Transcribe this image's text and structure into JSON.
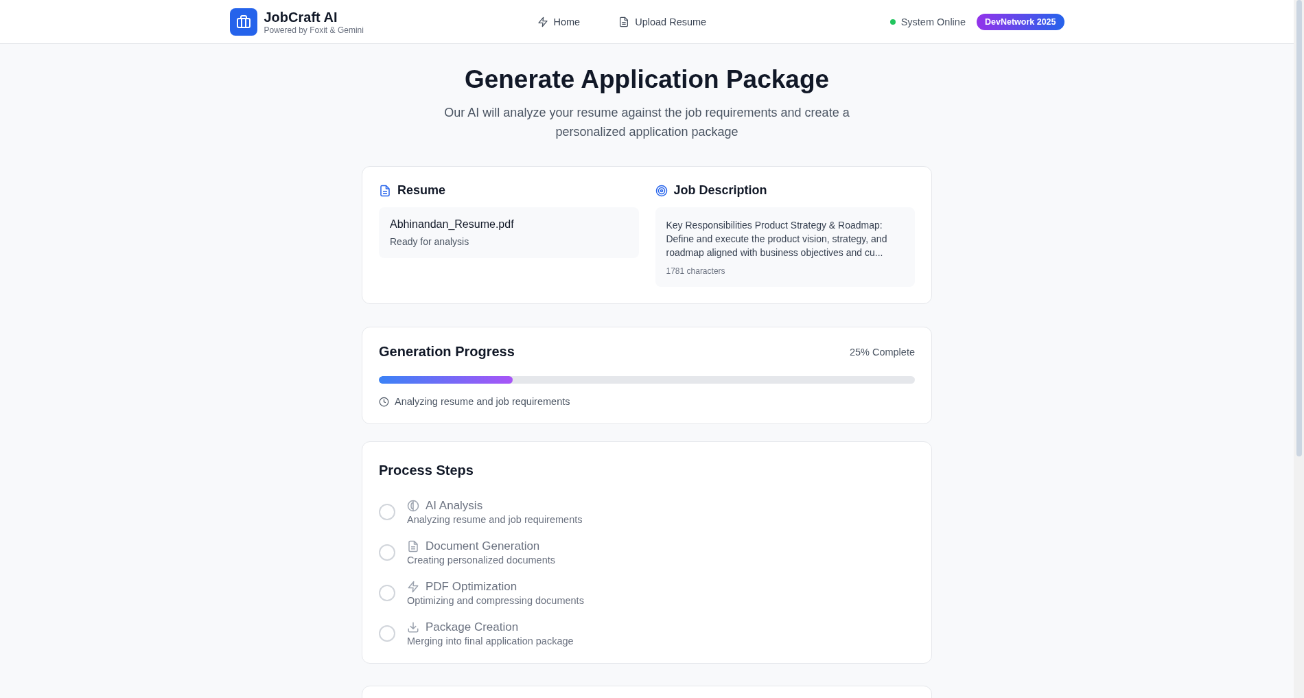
{
  "header": {
    "brand": "JobCraft AI",
    "tagline": "Powered by Foxit & Gemini",
    "nav": [
      {
        "label": "Home",
        "kind": "bolt"
      },
      {
        "label": "Upload Resume",
        "kind": "doc"
      }
    ],
    "status": {
      "label": "System Online",
      "color": "#22c55e"
    },
    "badge": "DevNetwork 2025"
  },
  "page": {
    "title": "Generate Application Package",
    "subtitle": "Our AI will analyze your resume against the job requirements and create a personalized application package"
  },
  "inputs": {
    "resume": {
      "heading": "Resume",
      "file": "Abhinandan_Resume.pdf",
      "status": "Ready for analysis"
    },
    "job": {
      "heading": "Job Description",
      "text": "Key Responsibilities Product Strategy & Roadmap: Define and execute the product vision, strategy, and roadmap aligned with business objectives and cu...",
      "count": "1781 characters"
    }
  },
  "progress": {
    "title": "Generation Progress",
    "reading": "25% Complete",
    "level": 0.25,
    "message": "Analyzing resume and job requirements"
  },
  "steps": {
    "title": "Process Steps",
    "items": [
      {
        "kind": "brain",
        "title": "AI Analysis",
        "detail": "Analyzing resume and job requirements",
        "done": false
      },
      {
        "kind": "doc",
        "title": "Document Generation",
        "detail": "Creating personalized documents",
        "done": false
      },
      {
        "kind": "bolt",
        "title": "PDF Optimization",
        "detail": "Optimizing and compressing documents",
        "done": false
      },
      {
        "kind": "download",
        "title": "Package Creation",
        "detail": "Merging into final application package",
        "done": false
      }
    ]
  }
}
